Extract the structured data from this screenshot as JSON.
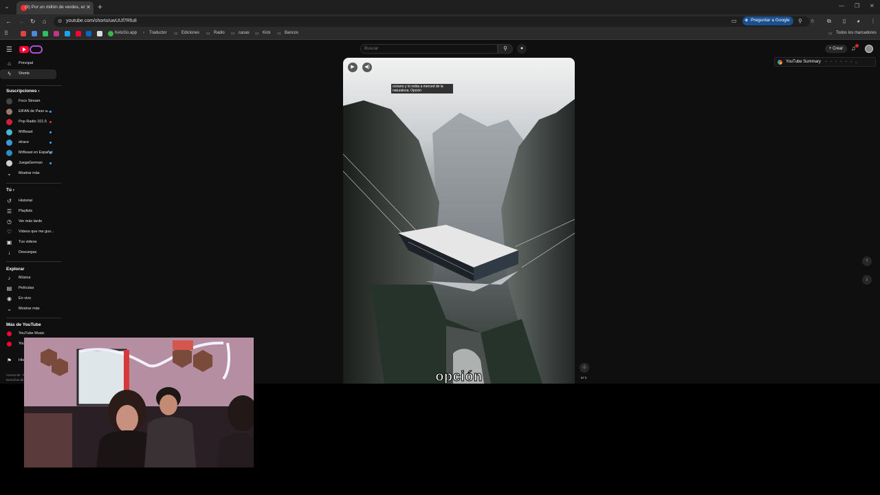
{
  "browser": {
    "tab_title": "(9) Por un millón de verdes, en",
    "url": "youtube.com/shorts/uwUUf7Rfu8",
    "ask_google": "Preguntar a Google",
    "all_bookmarks": "Todos los marcadores",
    "bookmarks": [
      "KetoGo.app",
      "Traductor",
      "Ediciones",
      "Radio",
      "casas",
      "Kick",
      "Bancos"
    ]
  },
  "youtube": {
    "search_placeholder": "Buscar",
    "create_label": "Crear",
    "extension": {
      "label": "YouTube Summary"
    },
    "sidebar": {
      "nav": [
        {
          "label": "Principal",
          "icon": "home-icon",
          "active": false
        },
        {
          "label": "Shorts",
          "icon": "shorts-icon",
          "active": true
        }
      ],
      "subscriptions_title": "Suscripciones",
      "subscriptions": [
        {
          "label": "Foco Stream",
          "color": "#444444",
          "live": false
        },
        {
          "label": "ElFAN de Paso a...",
          "color": "#9a7a6a",
          "live": true
        },
        {
          "label": "Pop Radio 101.5",
          "color": "#d1203b",
          "live": true
        },
        {
          "label": "MrBeast",
          "color": "#47b5d6",
          "live": true
        },
        {
          "label": "elrace",
          "color": "#3a9ad9",
          "live": true
        },
        {
          "label": "MrBeast en Español",
          "color": "#2e8bc0",
          "live": true
        },
        {
          "label": "JuegaGerman",
          "color": "#cfcfcf",
          "live": true
        }
      ],
      "show_more": "Mostrar más",
      "you_title": "Tú",
      "you_items": [
        {
          "label": "Historial",
          "icon": "history-icon"
        },
        {
          "label": "Playlists",
          "icon": "playlist-icon"
        },
        {
          "label": "Ver más tarde",
          "icon": "clock-icon"
        },
        {
          "label": "Videos que me gus...",
          "icon": "thumb-up-icon"
        },
        {
          "label": "Tus videos",
          "icon": "video-icon"
        },
        {
          "label": "Descargas",
          "icon": "download-icon"
        }
      ],
      "explore_title": "Explorar",
      "explore_items": [
        {
          "label": "Música",
          "icon": "music-icon"
        },
        {
          "label": "Películas",
          "icon": "film-icon"
        },
        {
          "label": "En vivo",
          "icon": "live-icon"
        }
      ],
      "show_more_2": "Mostrar más",
      "more_title": "Más de YouTube",
      "more_items": [
        {
          "label": "YouTube Music",
          "color": "#ff0033"
        },
        {
          "label": "YouTube Kids",
          "color": "#ff0033"
        }
      ],
      "history_item": "Historial",
      "footer_1": "Acerca de · Prensa",
      "footer_2": "Derechos de autor"
    },
    "video": {
      "caption": "océano y tú estás a merced de la naturaleza. Opción",
      "big_subtitle": "opción",
      "like_count": "87 k"
    }
  }
}
